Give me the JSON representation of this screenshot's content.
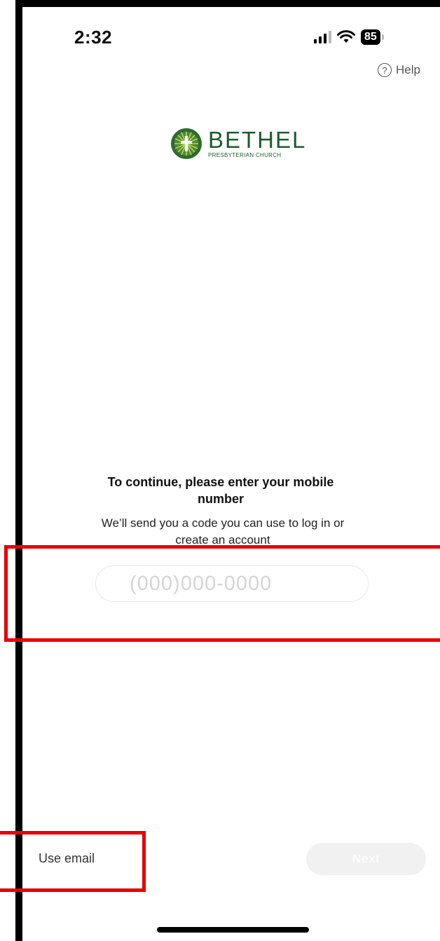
{
  "status_bar": {
    "time": "2:32",
    "battery": "85",
    "icons": [
      "signal-icon",
      "wifi-icon",
      "battery-icon"
    ]
  },
  "help": {
    "label": "Help",
    "icon": "question-circle-icon"
  },
  "logo": {
    "name": "BETHEL",
    "subtitle": "PRESBYTERIAN CHURCH",
    "color": "#1e5b2e"
  },
  "prompt": {
    "title": "To continue, please enter your mobile number",
    "subtitle": "We’ll send you a code you can use to log in or create an account"
  },
  "phone_input": {
    "placeholder": "(000)000-0000",
    "value": ""
  },
  "footer": {
    "use_email_label": "Use email",
    "next_label": "Next"
  },
  "colors": {
    "highlight": "#e60000",
    "brand_green": "#1e5b2e",
    "next_button_bg": "#f1f1f1"
  }
}
